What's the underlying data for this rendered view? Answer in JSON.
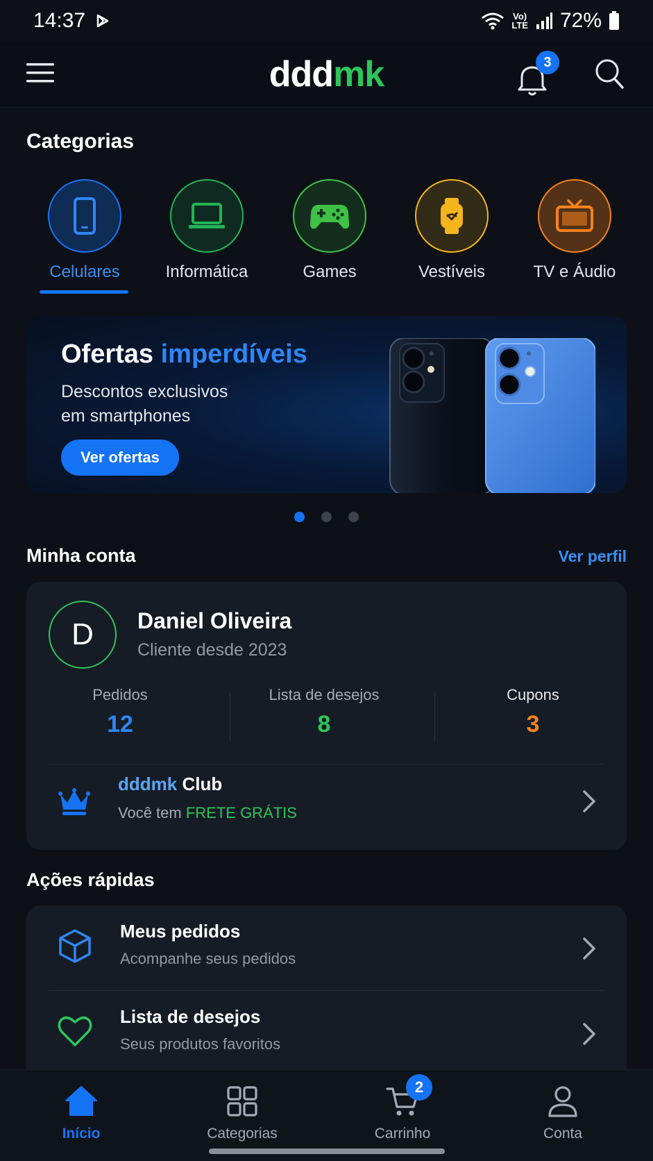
{
  "status_bar": {
    "time": "14:37",
    "battery": "72%",
    "lte_top": "Vo)",
    "lte_bottom": "LTE"
  },
  "header": {
    "logo_part1": "ddd",
    "logo_part2": "mk",
    "notification_count": "3",
    "brand_green": "#2ec45a",
    "accent_blue": "#1573f5"
  },
  "categories": {
    "title": "Categorias",
    "items": [
      {
        "label": "Celulares",
        "icon": "phone-icon",
        "color": "#1573f5",
        "active": true
      },
      {
        "label": "Informática",
        "icon": "laptop-icon",
        "color": "#22b455",
        "active": false
      },
      {
        "label": "Games",
        "icon": "gamepad-icon",
        "color": "#3fc145",
        "active": false
      },
      {
        "label": "Vestíveis",
        "icon": "watch-icon",
        "color": "#f5b51c",
        "active": false
      },
      {
        "label": "TV e Áudio",
        "icon": "tv-icon",
        "color": "#f5821c",
        "active": false
      }
    ]
  },
  "banner": {
    "title_part1": "Ofertas ",
    "title_part2": "imperdíveis",
    "subtitle_line1": "Descontos exclusivos",
    "subtitle_line2": "em smartphones",
    "button": "Ver ofertas",
    "pages": 3,
    "active_page": 1
  },
  "account": {
    "title": "Minha conta",
    "link": "Ver perfil",
    "avatar_initial": "D",
    "name": "Daniel Oliveira",
    "since": "Cliente desde 2023",
    "stats": [
      {
        "label": "Pedidos",
        "value": "12",
        "color": "#2f86f5"
      },
      {
        "label": "Lista de desejos",
        "value": "8",
        "color": "#2ec45a"
      },
      {
        "label": "Cupons",
        "value": "3",
        "color": "#f5821c"
      }
    ],
    "club": {
      "title_part1": "dddmk",
      "title_part2": " Club",
      "sub_part1": "Você tem ",
      "sub_part2": "FRETE GRÁTIS"
    }
  },
  "quick_actions": {
    "title": "Ações rápidas",
    "items": [
      {
        "title": "Meus pedidos",
        "subtitle": "Acompanhe seus pedidos",
        "icon": "box-icon"
      },
      {
        "title": "Lista de desejos",
        "subtitle": "Seus produtos favoritos",
        "icon": "heart-icon"
      }
    ]
  },
  "bottom_nav": {
    "items": [
      {
        "label": "Início",
        "icon": "home-icon",
        "active": true
      },
      {
        "label": "Categorias",
        "icon": "grid-icon",
        "active": false
      },
      {
        "label": "Carrinho",
        "icon": "cart-icon",
        "active": false
      },
      {
        "label": "Conta",
        "icon": "user-icon",
        "active": false
      }
    ],
    "cart_count": "2"
  }
}
